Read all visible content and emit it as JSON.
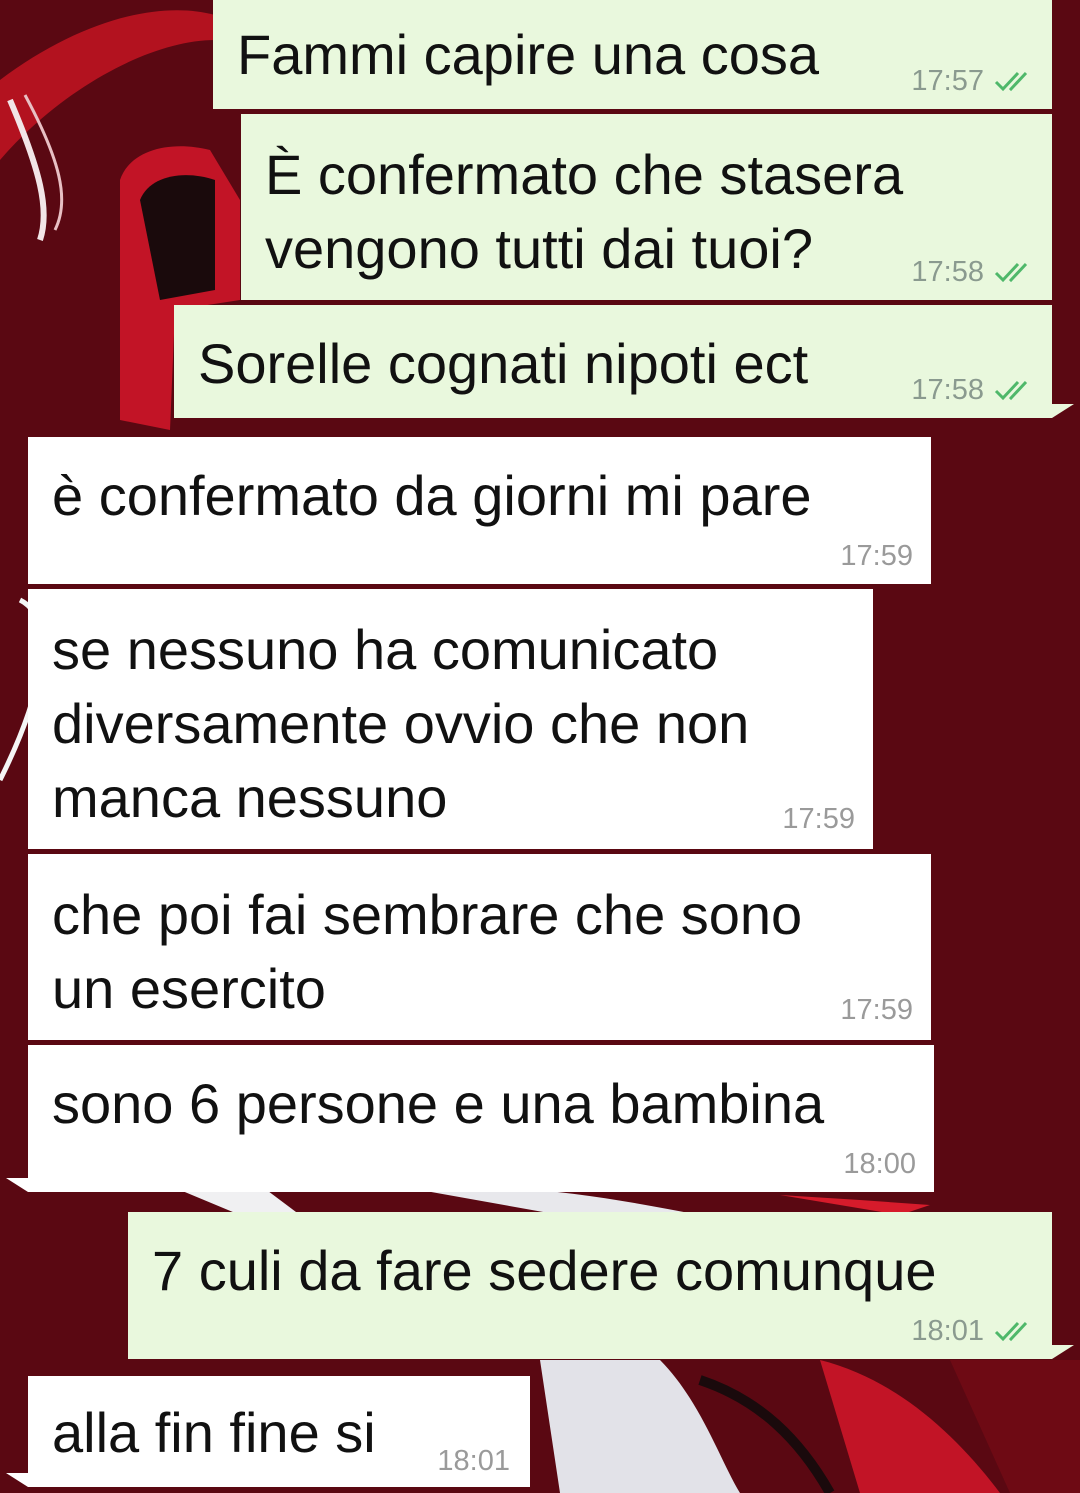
{
  "chat": {
    "messages": [
      {
        "text": "Fammi capire una cosa",
        "time": "17:57",
        "dir": "out"
      },
      {
        "text": "È confermato che stasera\nvengono tutti dai tuoi?",
        "time": "17:58",
        "dir": "out"
      },
      {
        "text": "Sorelle cognati nipoti ect",
        "time": "17:58",
        "dir": "out"
      },
      {
        "text": "è confermato da giorni mi pare",
        "time": "17:59",
        "dir": "in"
      },
      {
        "text": "se nessuno ha comunicato\ndiversamente ovvio che non\nmanca nessuno",
        "time": "17:59",
        "dir": "in"
      },
      {
        "text": "che poi fai sembrare che sono\nun esercito",
        "time": "17:59",
        "dir": "in"
      },
      {
        "text": "sono 6 persone e una bambina",
        "time": "18:00",
        "dir": "in"
      },
      {
        "text": "7 culi da fare sedere comunque",
        "time": "18:01",
        "dir": "out"
      },
      {
        "text": "alla fin fine si",
        "time": "18:01",
        "dir": "in"
      }
    ]
  },
  "icons": {
    "read_receipt": "double-check-icon"
  },
  "colors": {
    "background": "#5a0812",
    "outgoing_bubble": "#e9f8dd",
    "incoming_bubble": "#ffffff",
    "read_ticks": "#4fb86a"
  }
}
